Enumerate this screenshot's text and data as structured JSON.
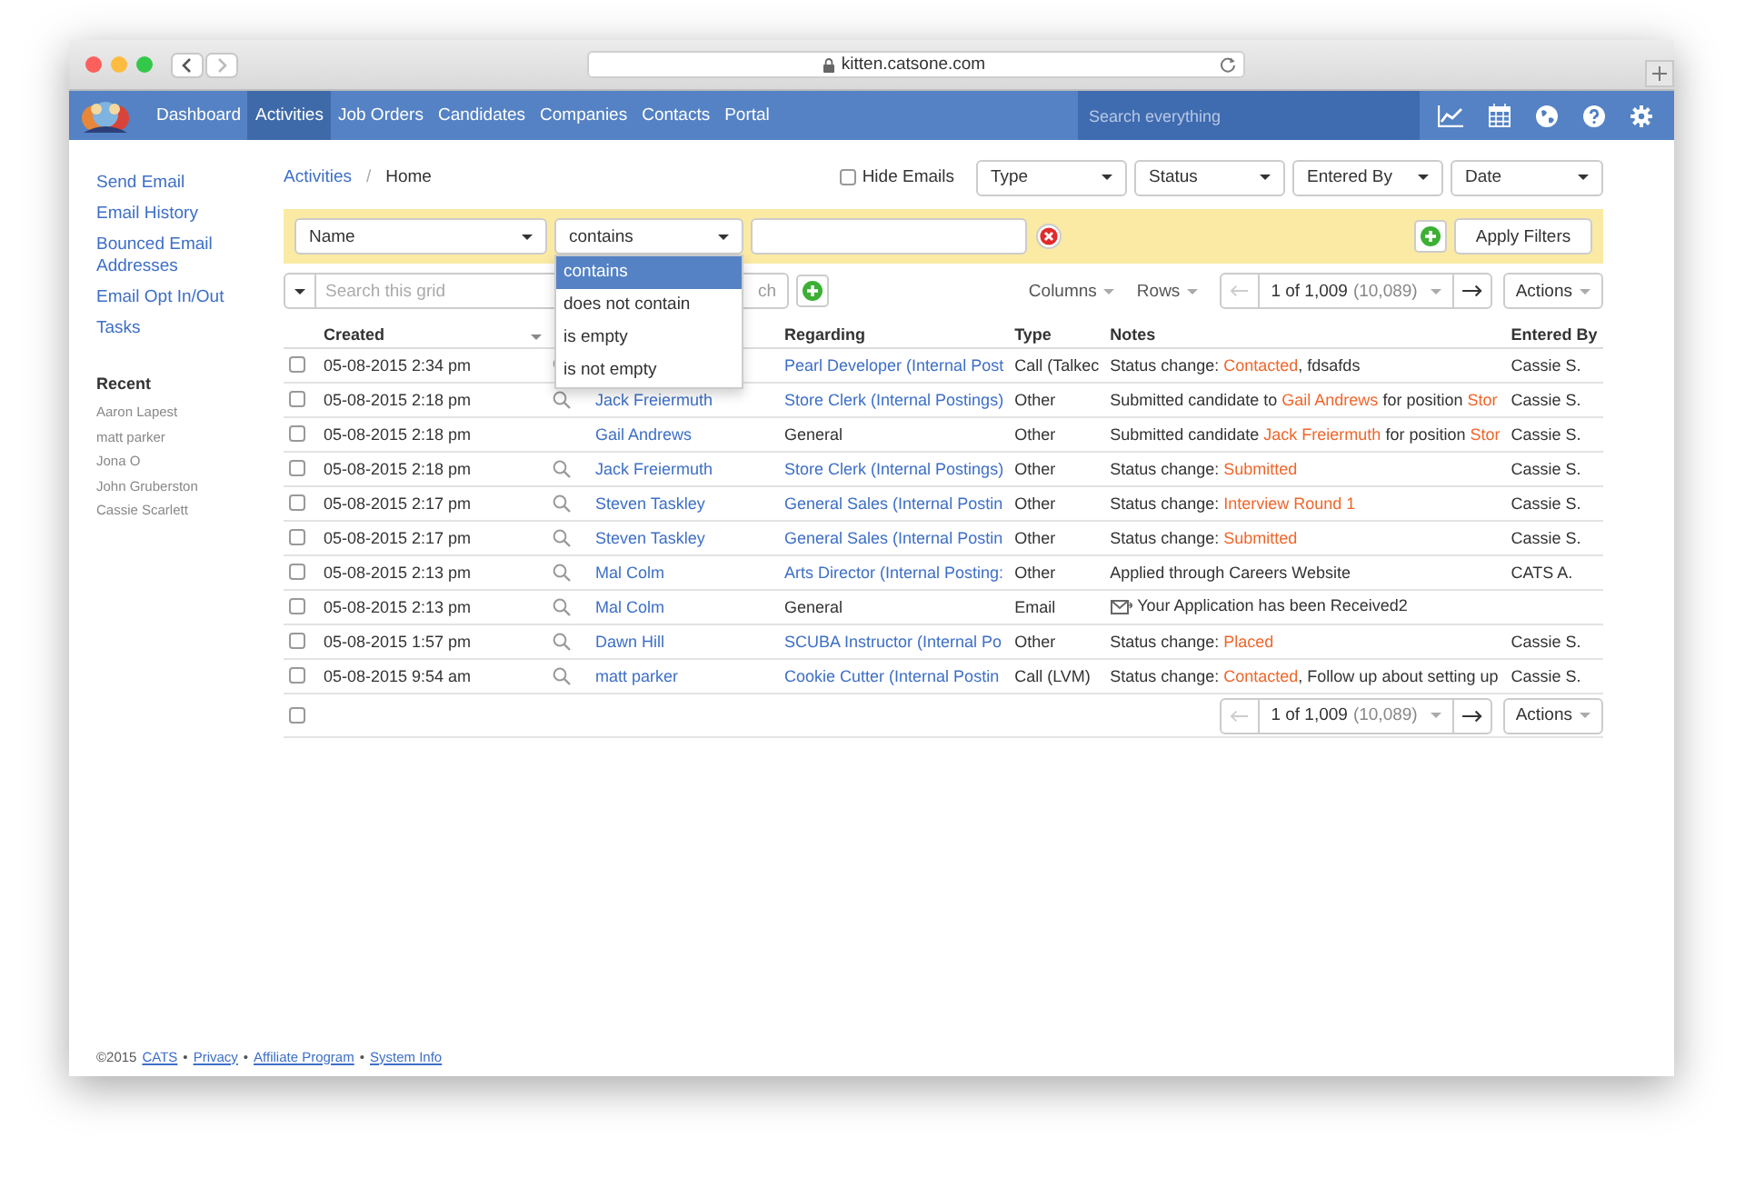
{
  "browser": {
    "url": "kitten.catsone.com"
  },
  "nav": {
    "items": [
      {
        "label": "Dashboard",
        "selected": false
      },
      {
        "label": "Activities",
        "selected": true
      },
      {
        "label": "Job Orders",
        "selected": false
      },
      {
        "label": "Candidates",
        "selected": false
      },
      {
        "label": "Companies",
        "selected": false
      },
      {
        "label": "Contacts",
        "selected": false
      },
      {
        "label": "Portal",
        "selected": false
      }
    ],
    "search": {
      "placeholder": "Search everything"
    }
  },
  "sidebar": {
    "links": [
      "Send Email",
      "Email History",
      "Bounced Email Addresses",
      "Email Opt In/Out",
      "Tasks"
    ],
    "recent_title": "Recent",
    "recent": [
      "Aaron Lapest",
      "matt parker",
      "Jona O",
      "John Gruberston",
      "Cassie Scarlett"
    ]
  },
  "breadcrumb": {
    "parent": "Activities",
    "separator": "/",
    "current": "Home"
  },
  "filters": {
    "hide_emails": {
      "label": "Hide Emails",
      "checked": false
    },
    "selects": [
      "Type",
      "Status",
      "Entered By",
      "Date"
    ]
  },
  "filter_bar": {
    "field": "Name",
    "operator": "contains",
    "options": [
      {
        "label": "contains",
        "selected": true
      },
      {
        "label": "does not contain",
        "selected": false
      },
      {
        "label": "is empty",
        "selected": false
      },
      {
        "label": "is not empty",
        "selected": false
      }
    ],
    "apply": "Apply Filters"
  },
  "grid_toolbar": {
    "search_placeholder": "Search this grid",
    "search_button": "ch",
    "columns": "Columns",
    "rows": "Rows",
    "pager": {
      "page": "1 of 1,009",
      "total": "(10,089)"
    },
    "actions": "Actions"
  },
  "table": {
    "columns": [
      {
        "label": "Created",
        "sortable": true
      },
      {
        "label": "Regarding",
        "sortable": false
      },
      {
        "label": "Type",
        "sortable": false
      },
      {
        "label": "Notes",
        "sortable": false
      },
      {
        "label": "Entered By",
        "sortable": false
      }
    ],
    "rows": [
      {
        "checked": false,
        "created": "05-08-2015 2:34 pm",
        "lookup": true,
        "regarding": "Pearl Developer (Internal Post",
        "regarding_link": true,
        "type": "Call (Talkec",
        "notes": [
          {
            "text": "Status change: ",
            "highlight": false
          },
          {
            "text": "Contacted",
            "highlight": true
          },
          {
            "text": ", fdsafds",
            "highlight": false
          }
        ],
        "entered_by": "Cassie S."
      },
      {
        "checked": false,
        "created": "05-08-2015 2:18 pm",
        "lookup": true,
        "name": "Jack Freiermuth",
        "regarding": "Store Clerk (Internal Postings)",
        "regarding_link": true,
        "type": "Other",
        "notes": [
          {
            "text": "Submitted candidate to ",
            "highlight": false
          },
          {
            "text": "Gail Andrews",
            "highlight": true
          },
          {
            "text": " for position ",
            "highlight": false
          },
          {
            "text": "Stor",
            "highlight": true
          }
        ],
        "entered_by": "Cassie S."
      },
      {
        "checked": false,
        "created": "05-08-2015 2:18 pm",
        "lookup": false,
        "name": "Gail Andrews",
        "regarding": "General",
        "regarding_link": false,
        "type": "Other",
        "notes": [
          {
            "text": "Submitted candidate ",
            "highlight": false
          },
          {
            "text": "Jack Freiermuth",
            "highlight": true
          },
          {
            "text": " for position ",
            "highlight": false
          },
          {
            "text": "Stor",
            "highlight": true
          }
        ],
        "entered_by": "Cassie S."
      },
      {
        "checked": false,
        "created": "05-08-2015 2:18 pm",
        "lookup": true,
        "name": "Jack Freiermuth",
        "regarding": "Store Clerk (Internal Postings)",
        "regarding_link": true,
        "type": "Other",
        "notes": [
          {
            "text": "Status change: ",
            "highlight": false
          },
          {
            "text": "Submitted",
            "highlight": true
          }
        ],
        "entered_by": "Cassie S."
      },
      {
        "checked": false,
        "created": "05-08-2015 2:17 pm",
        "lookup": true,
        "name": "Steven Taskley",
        "regarding": "General Sales (Internal Postin",
        "regarding_link": true,
        "type": "Other",
        "notes": [
          {
            "text": "Status change: ",
            "highlight": false
          },
          {
            "text": "Interview Round 1",
            "highlight": true
          }
        ],
        "entered_by": "Cassie S."
      },
      {
        "checked": false,
        "created": "05-08-2015 2:17 pm",
        "lookup": true,
        "name": "Steven Taskley",
        "regarding": "General Sales (Internal Postin",
        "regarding_link": true,
        "type": "Other",
        "notes": [
          {
            "text": "Status change: ",
            "highlight": false
          },
          {
            "text": "Submitted",
            "highlight": true
          }
        ],
        "entered_by": "Cassie S."
      },
      {
        "checked": false,
        "created": "05-08-2015 2:13 pm",
        "lookup": true,
        "name": "Mal Colm",
        "regarding": "Arts Director (Internal Posting:",
        "regarding_link": true,
        "type": "Other",
        "notes": [
          {
            "text": "Applied through Careers Website",
            "highlight": false
          }
        ],
        "entered_by": "CATS A."
      },
      {
        "checked": false,
        "created": "05-08-2015 2:13 pm",
        "lookup": true,
        "name": "Mal Colm",
        "regarding": "General",
        "regarding_link": false,
        "type": "Email",
        "email": true,
        "notes": [
          {
            "text": "Your Application has been Received2",
            "highlight": false
          }
        ]
      },
      {
        "checked": false,
        "created": "05-08-2015 1:57 pm",
        "lookup": true,
        "name": "Dawn Hill",
        "regarding": "SCUBA Instructor (Internal Po",
        "regarding_link": true,
        "type": "Other",
        "notes": [
          {
            "text": "Status change: ",
            "highlight": false
          },
          {
            "text": "Placed",
            "highlight": true
          }
        ],
        "entered_by": "Cassie S."
      },
      {
        "checked": false,
        "created": "05-08-2015 9:54 am",
        "lookup": true,
        "name": "matt parker",
        "regarding": "Cookie Cutter (Internal Postin",
        "regarding_link": true,
        "type": "Call (LVM)",
        "notes": [
          {
            "text": "Status change: ",
            "highlight": false
          },
          {
            "text": "Contacted",
            "highlight": true
          },
          {
            "text": ", Follow up about setting up",
            "highlight": false
          }
        ],
        "entered_by": "Cassie S."
      }
    ],
    "select_all_checked": false
  },
  "bottom_pager": {
    "page": "1 of 1,009",
    "total": "(10,089)",
    "actions": "Actions"
  },
  "footer": [
    {
      "text": "©2015",
      "link": false
    },
    {
      "text": "CATS",
      "link": true
    },
    {
      "text": "•",
      "link": false
    },
    {
      "text": "Privacy",
      "link": true
    },
    {
      "text": "•",
      "link": false
    },
    {
      "text": "Affiliate Program",
      "link": true
    },
    {
      "text": "•",
      "link": false
    },
    {
      "text": "System Info",
      "link": true
    }
  ]
}
